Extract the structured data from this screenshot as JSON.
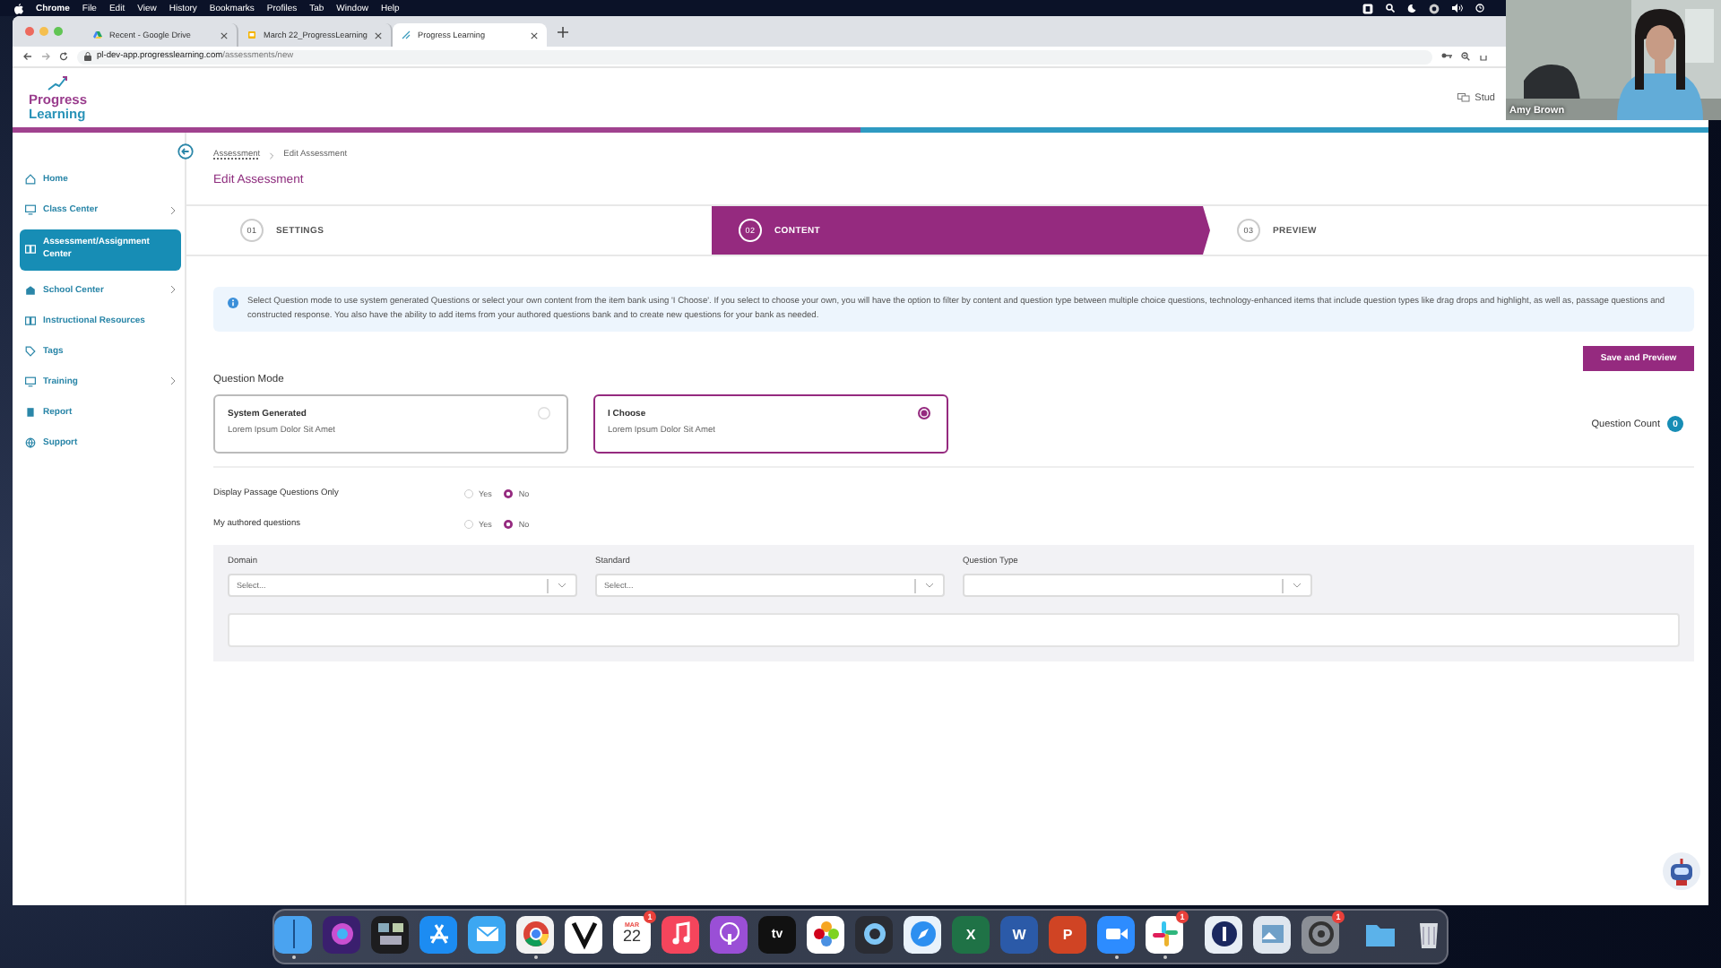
{
  "menubar": {
    "app": "Chrome",
    "menus": [
      "File",
      "Edit",
      "View",
      "History",
      "Bookmarks",
      "Profiles",
      "Tab",
      "Window",
      "Help"
    ]
  },
  "browser": {
    "tabs": [
      {
        "title": "Recent - Google Drive",
        "selected": false
      },
      {
        "title": "March 22_ProgressLearning",
        "selected": false
      },
      {
        "title": "Progress Learning",
        "selected": true
      }
    ],
    "url_host": "pl-dev-app.progresslearning.com",
    "url_path": "/assessments/new"
  },
  "header": {
    "logo_top": "Progress",
    "logo_bottom": "Learning",
    "user_link": "Stud"
  },
  "video": {
    "name": "Amy Brown"
  },
  "sidebar": {
    "items": [
      {
        "label": "Home",
        "kind": "home",
        "expandable": false,
        "selected": false
      },
      {
        "label": "Class Center",
        "kind": "monitor",
        "expandable": true,
        "selected": false
      },
      {
        "label": "Assessment/Assignment Center",
        "kind": "book",
        "expandable": false,
        "selected": true
      },
      {
        "label": "School Center",
        "kind": "building",
        "expandable": true,
        "selected": false
      },
      {
        "label": "Instructional Resources",
        "kind": "open-book",
        "expandable": false,
        "selected": false
      },
      {
        "label": "Tags",
        "kind": "tag",
        "expandable": false,
        "selected": false
      },
      {
        "label": "Training",
        "kind": "monitor",
        "expandable": true,
        "selected": false
      },
      {
        "label": "Report",
        "kind": "clipboard",
        "expandable": false,
        "selected": false
      },
      {
        "label": "Support",
        "kind": "globe",
        "expandable": false,
        "selected": false
      }
    ]
  },
  "breadcrumb": [
    "Assessment",
    "Edit Assessment"
  ],
  "page_title": "Edit Assessment",
  "steps": [
    {
      "number": "01",
      "label": "SETTINGS",
      "selected": false
    },
    {
      "number": "02",
      "label": "CONTENT",
      "selected": true
    },
    {
      "number": "03",
      "label": "PREVIEW",
      "selected": false
    }
  ],
  "info": "Select Question mode to use system generated Questions or select your own content from the item bank using 'I Choose'. If you select to choose your own, you will have the option to filter by content and question type between multiple choice questions, technology-enhanced items that include question types like drag drops and highlight, as well as, passage questions and constructed response. You also have the ability to add items from your authored questions bank and to create new questions for your bank as needed.",
  "save_button": "Save and Preview",
  "question_mode": {
    "label": "Question Mode",
    "options": [
      {
        "title": "System Generated",
        "subtitle": "Lorem Ipsum Dolor Sit Amet",
        "selected": false
      },
      {
        "title": "I Choose",
        "subtitle": "Lorem Ipsum Dolor Sit Amet",
        "selected": true
      }
    ]
  },
  "question_count": {
    "label": "Question Count",
    "value": "0"
  },
  "toggles": [
    {
      "label": "Display Passage Questions Only",
      "options": [
        {
          "label": "Yes",
          "selected": false
        },
        {
          "label": "No",
          "selected": true
        }
      ]
    },
    {
      "label": "My authored questions",
      "options": [
        {
          "label": "Yes",
          "selected": false
        },
        {
          "label": "No",
          "selected": true
        }
      ]
    }
  ],
  "filters": [
    {
      "label": "Domain",
      "placeholder": "Select..."
    },
    {
      "label": "Standard",
      "placeholder": "Select..."
    },
    {
      "label": "Question Type"
    }
  ],
  "dock": {
    "items": [
      {
        "kind": "finder",
        "running": true
      },
      {
        "kind": "siri",
        "running": false
      },
      {
        "kind": "mission",
        "running": false
      },
      {
        "kind": "appstore",
        "running": false
      },
      {
        "kind": "mail",
        "running": false
      },
      {
        "kind": "chrome",
        "running": true
      },
      {
        "kind": "vee",
        "running": false
      },
      {
        "kind": "calendar",
        "month": "MAR",
        "day": "22",
        "badge": "1",
        "running": false
      },
      {
        "kind": "music",
        "running": false
      },
      {
        "kind": "podcasts",
        "running": false
      },
      {
        "kind": "tv",
        "text": "tv",
        "running": false
      },
      {
        "kind": "photos",
        "running": false
      },
      {
        "kind": "quicktime",
        "running": false
      },
      {
        "kind": "safari",
        "running": false
      },
      {
        "kind": "excel",
        "text": "X",
        "running": false
      },
      {
        "kind": "word",
        "text": "W",
        "running": false
      },
      {
        "kind": "powerpoint",
        "text": "P",
        "running": false
      },
      {
        "kind": "zoom",
        "running": true
      },
      {
        "kind": "slack",
        "badge": "1",
        "running": true
      },
      {
        "kind": "separator"
      },
      {
        "kind": "password",
        "running": false
      },
      {
        "kind": "preview",
        "running": false
      },
      {
        "kind": "settings",
        "badge": "1",
        "running": false
      },
      {
        "kind": "separator"
      },
      {
        "kind": "folder",
        "running": false
      },
      {
        "kind": "trash",
        "running": false
      }
    ]
  }
}
